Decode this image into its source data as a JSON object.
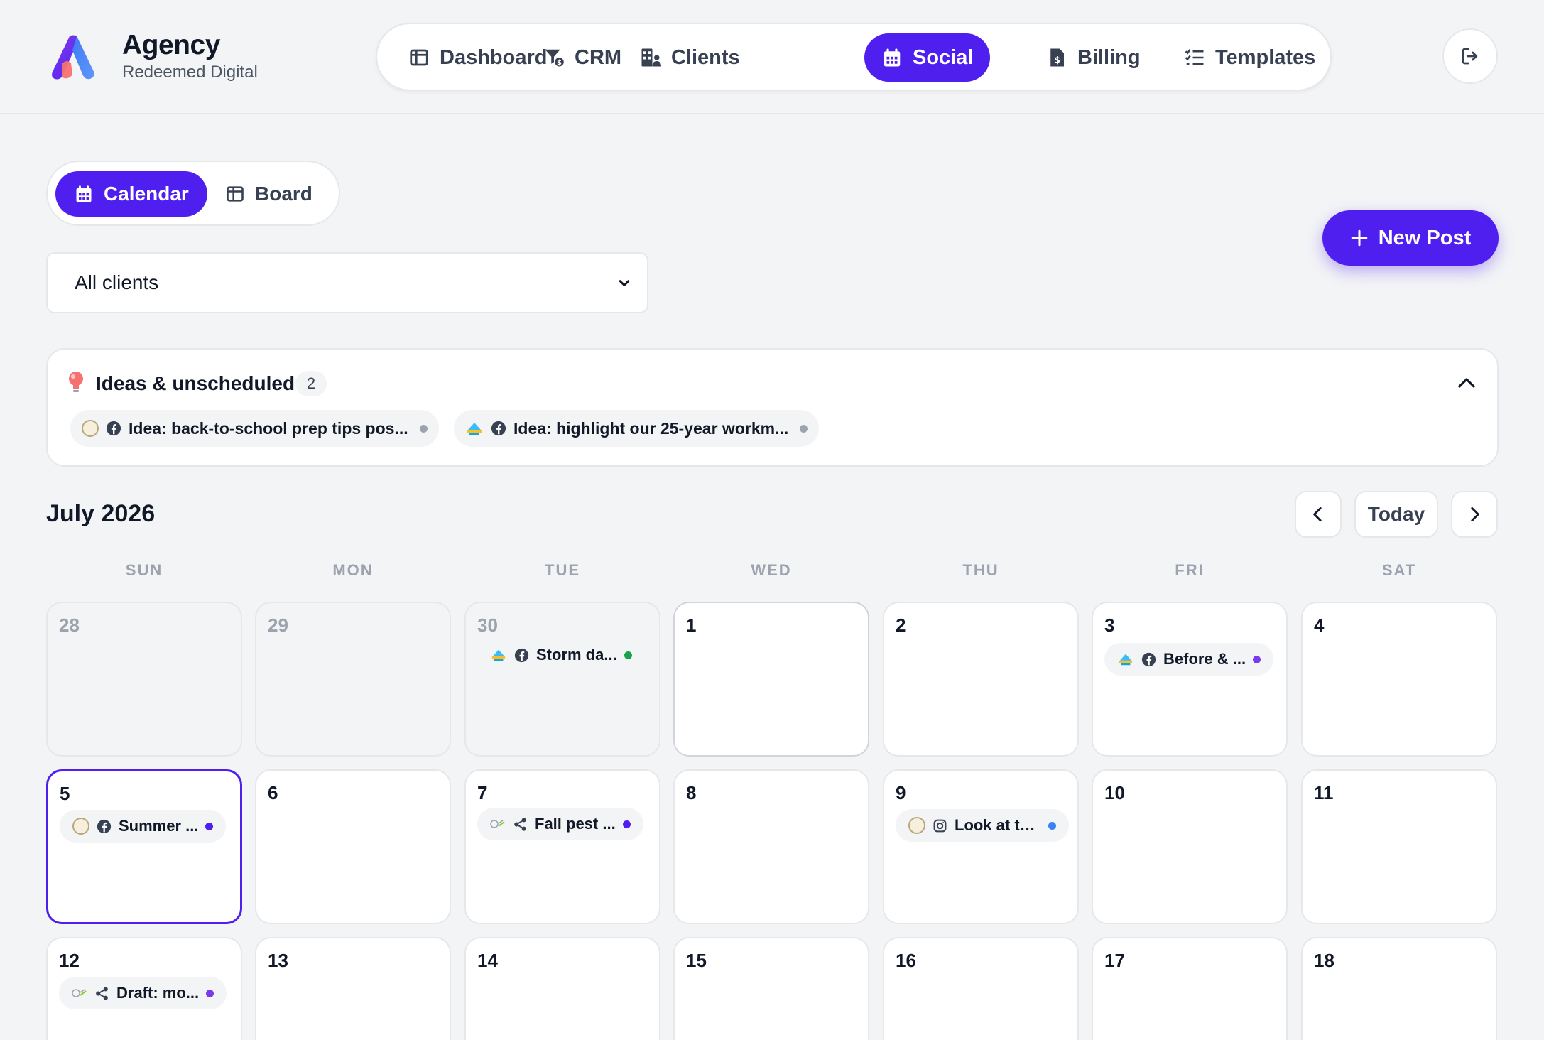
{
  "brand": {
    "title": "Agency",
    "subtitle": "Redeemed Digital"
  },
  "nav": {
    "dashboard": "Dashboard",
    "crm": "CRM",
    "clients": "Clients",
    "social": "Social",
    "billing": "Billing",
    "templates": "Templates"
  },
  "views": {
    "calendar": "Calendar",
    "board": "Board"
  },
  "new_post": "New Post",
  "client_filter": {
    "selected": "All clients"
  },
  "ideas": {
    "title": "Ideas & unscheduled",
    "count": "2",
    "items": [
      {
        "text": "Idea: back-to-school prep tips pos...",
        "icon": "facebook-icon"
      },
      {
        "text": "Idea: highlight our 25-year workm...",
        "icon": "facebook-icon"
      }
    ]
  },
  "calendar": {
    "month": "July 2026",
    "today": "Today",
    "weekdays": [
      "SUN",
      "MON",
      "TUE",
      "WED",
      "THU",
      "FRI",
      "SAT"
    ],
    "days": [
      "28",
      "29",
      "30",
      "1",
      "2",
      "3",
      "4",
      "5",
      "6",
      "7",
      "8",
      "9",
      "10",
      "11",
      "12",
      "13",
      "14",
      "15",
      "16",
      "17",
      "18"
    ],
    "posts": {
      "d30": "Storm da...",
      "d3": "Before & ...",
      "d5": "Summer ...",
      "d7": "Fall pest ...",
      "d9": "Look at th...",
      "d12": "Draft: mo..."
    }
  },
  "colors": {
    "accent": "#4f1ff0",
    "status_green": "#16a34a",
    "status_purple": "#7c3aed",
    "status_blue": "#3b82f6",
    "status_indigo": "#4f1ff0",
    "status_gray": "#9ca3af"
  }
}
